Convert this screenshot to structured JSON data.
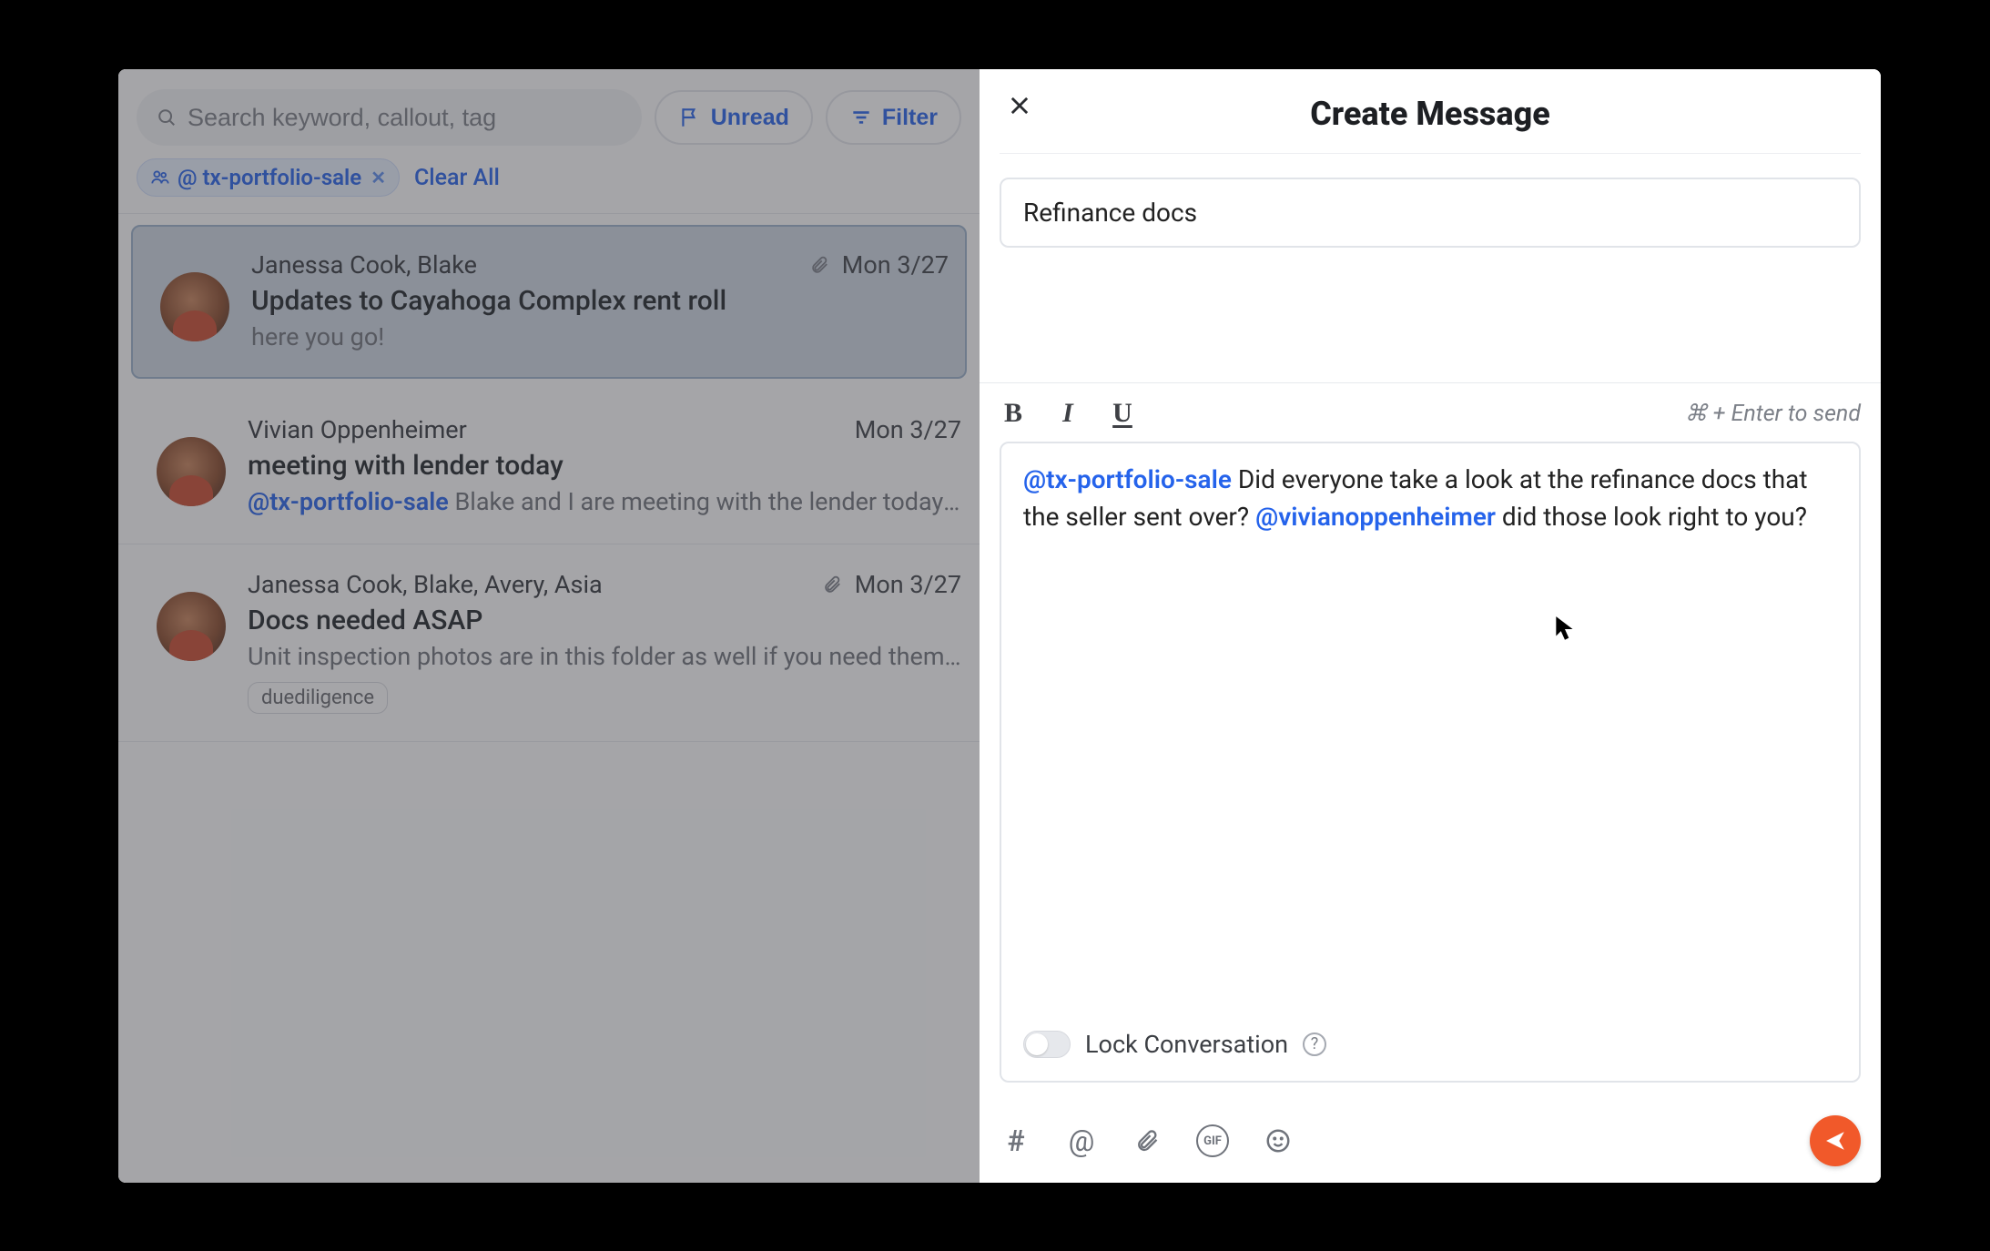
{
  "search": {
    "placeholder": "Search keyword, callout, tag"
  },
  "filters": {
    "unread_label": "Unread",
    "filter_label": "Filter",
    "chip_label": "@ tx-portfolio-sale",
    "clear_all": "Clear All"
  },
  "messages": [
    {
      "senders": "Janessa Cook, Blake",
      "date": "Mon 3/27",
      "has_attachment": true,
      "subject": "Updates to Cayahoga Complex rent roll",
      "preview": "here you go!",
      "selected": true,
      "tags": []
    },
    {
      "senders": "Vivian Oppenheimer",
      "date": "Mon 3/27",
      "has_attachment": false,
      "subject": "meeting with lender today",
      "preview_mention": "@tx-portfolio-sale",
      "preview": "Blake and I are meeting with the lender today t…",
      "selected": false,
      "tags": []
    },
    {
      "senders": "Janessa Cook, Blake, Avery, Asia",
      "date": "Mon 3/27",
      "has_attachment": true,
      "subject": "Docs needed ASAP",
      "preview": "Unit inspection photos are in this folder as well if you need them…",
      "selected": false,
      "tags": [
        "duediligence"
      ]
    }
  ],
  "compose": {
    "title": "Create Message",
    "subject_value": "Refinance docs",
    "send_hint": "⌘ + Enter to send",
    "body_parts": {
      "mention1": "@tx-portfolio-sale",
      "text1": " Did everyone take a look at the refinance docs that the seller sent over? ",
      "mention2": "@vivianoppenheimer",
      "text2": " did those look right to you?"
    },
    "lock_label": "Lock Conversation"
  },
  "format_buttons": {
    "bold": "B",
    "italic": "I",
    "underline": "U"
  },
  "icons": {
    "hash": "#",
    "at": "@",
    "gif": "GIF"
  }
}
